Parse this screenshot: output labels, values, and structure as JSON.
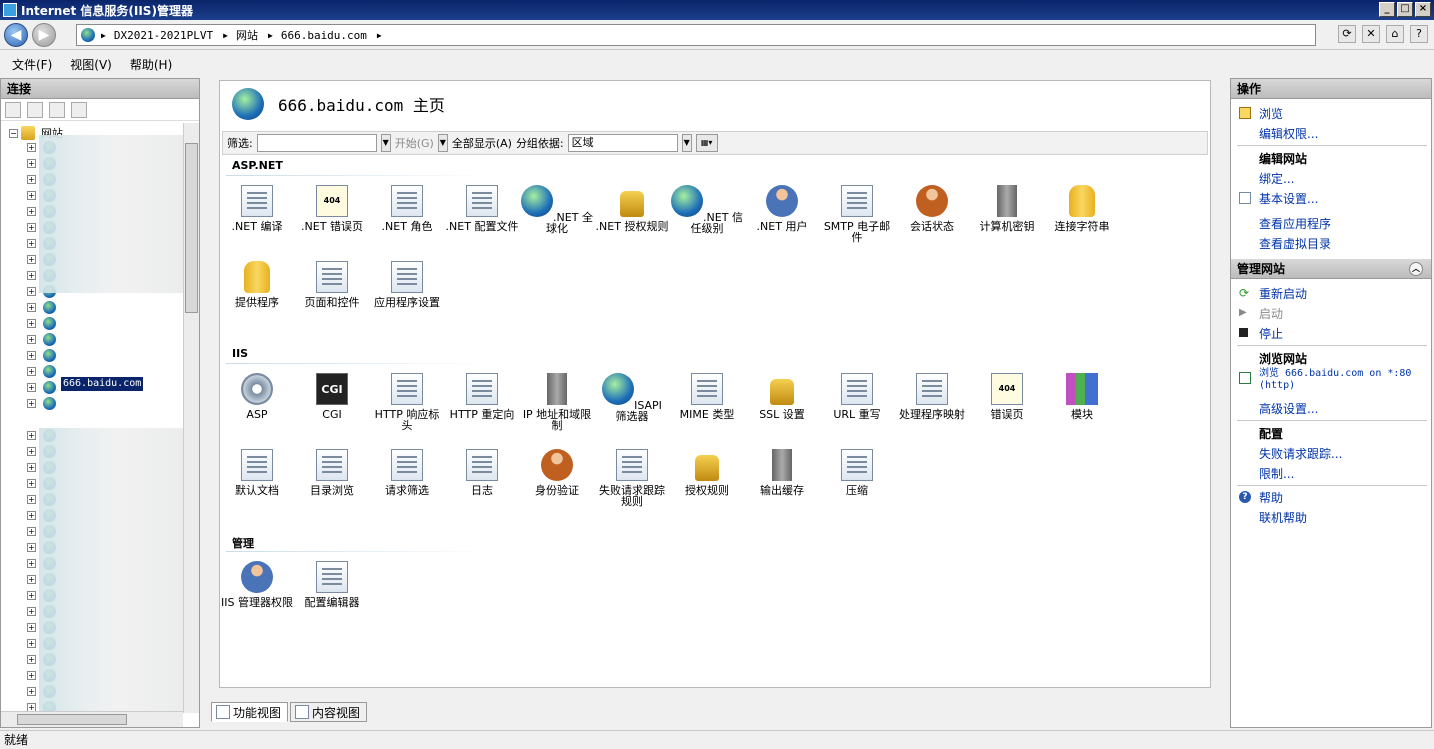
{
  "window": {
    "title": "Internet 信息服务(IIS)管理器",
    "controls": [
      "minimize-icon",
      "maximize-icon",
      "close-icon"
    ]
  },
  "address": {
    "crumbs": [
      "DX2021-2021PLVT",
      "网站",
      "666.baidu.com"
    ]
  },
  "menu": [
    "文件(F)",
    "视图(V)",
    "帮助(H)"
  ],
  "connections": {
    "header": "连接",
    "root_label": "网站",
    "selected_site": "666.baidu.com"
  },
  "page": {
    "title": "666.baidu.com 主页",
    "filter_label": "筛选:",
    "start_label": "开始(G)",
    "show_all_label": "全部显示(A)",
    "group_label": "分组依据:",
    "group_value": "区域"
  },
  "sections": {
    "aspnet": {
      "title": "ASP.NET",
      "items": [
        ".NET 编译",
        ".NET 错误页",
        ".NET 角色",
        ".NET 配置文件",
        ".NET 全球化",
        ".NET 授权规则",
        ".NET 信任级别",
        ".NET 用户",
        "SMTP 电子邮件",
        "会话状态",
        "计算机密钥",
        "连接字符串",
        "提供程序",
        "页面和控件",
        "应用程序设置"
      ]
    },
    "iis": {
      "title": "IIS",
      "items": [
        "ASP",
        "CGI",
        "HTTP 响应标头",
        "HTTP 重定向",
        "IP 地址和域限制",
        "ISAPI 筛选器",
        "MIME 类型",
        "SSL 设置",
        "URL 重写",
        "处理程序映射",
        "错误页",
        "模块",
        "默认文档",
        "目录浏览",
        "请求筛选",
        "日志",
        "身份验证",
        "失败请求跟踪规则",
        "授权规则",
        "输出缓存",
        "压缩"
      ]
    },
    "management": {
      "title": "管理",
      "items": [
        "IIS 管理器权限",
        "配置编辑器"
      ]
    }
  },
  "view_tabs": [
    "功能视图",
    "内容视图"
  ],
  "actions": {
    "header": "操作",
    "browse": "浏览",
    "edit_permissions": "编辑权限...",
    "edit_site_title": "编辑网站",
    "bindings": "绑定...",
    "basic_settings": "基本设置...",
    "view_apps": "查看应用程序",
    "view_vdirs": "查看虚拟目录",
    "manage_site_header": "管理网站",
    "restart": "重新启动",
    "start": "启动",
    "stop": "停止",
    "browse_site_title": "浏览网站",
    "browse_url": "浏览 666.baidu.com on *:80 (http)",
    "advanced_settings": "高级设置...",
    "config_title": "配置",
    "failed_request_tracing": "失败请求跟踪...",
    "limits": "限制...",
    "help": "帮助",
    "online_help": "联机帮助"
  },
  "status": {
    "text": "就绪"
  }
}
